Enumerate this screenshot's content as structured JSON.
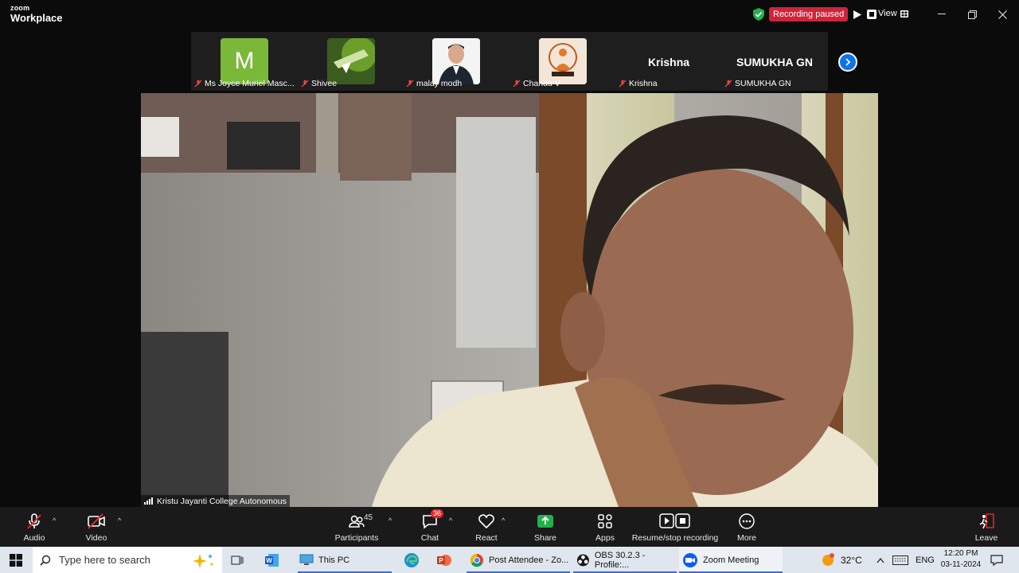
{
  "app": {
    "logo_top": "zoom",
    "logo_bottom": "Workplace"
  },
  "recording": {
    "status": "Recording paused"
  },
  "titlebar": {
    "view_label": "View"
  },
  "participants_strip": [
    {
      "caption": "Ms Joyce Muriel Masc...",
      "avatar": "letter",
      "letter": "M",
      "avatar_color": "#7ab83a"
    },
    {
      "caption": "Shivee",
      "avatar": "image"
    },
    {
      "caption": "malay modh",
      "avatar": "photo"
    },
    {
      "caption": "Chandu V",
      "avatar": "photo"
    },
    {
      "caption": "Krishna",
      "avatar": "name",
      "display": "Krishna"
    },
    {
      "caption": "SUMUKHA GN",
      "avatar": "name",
      "display": "SUMUKHA GN"
    }
  ],
  "main_video": {
    "label": "Kristu Jayanti College Autonomous"
  },
  "toolbar": {
    "audio": "Audio",
    "video": "Video",
    "participants": "Participants",
    "participants_count": "45",
    "chat": "Chat",
    "chat_badge": "36",
    "react": "React",
    "share": "Share",
    "apps": "Apps",
    "recording": "Resume/stop recording",
    "more": "More",
    "leave": "Leave"
  },
  "taskbar": {
    "search_placeholder": "Type here to search",
    "apps": [
      {
        "label": "This PC"
      },
      {
        "label": "Post Attendee - Zo..."
      },
      {
        "label": "OBS 30.2.3 - Profile:..."
      },
      {
        "label": "Zoom Meeting"
      }
    ],
    "weather": "32°C",
    "language": "ENG",
    "time": "12:20 PM",
    "date": "03-11-2024"
  },
  "colors": {
    "accent": "#0e72ed",
    "recording_red": "#d0233a",
    "share_green": "#22b14c"
  }
}
